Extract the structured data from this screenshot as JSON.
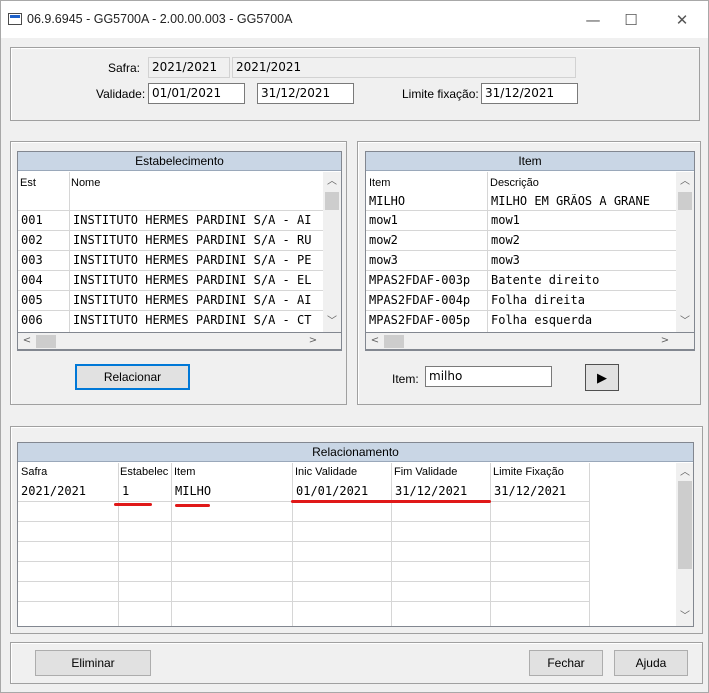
{
  "window": {
    "title": "06.9.6945 - GG5700A - 2.00.00.003 - GG5700A",
    "minimize": "—",
    "maximize": "☐",
    "close": "✕"
  },
  "top": {
    "safra_label": "Safra:",
    "safra_value1": "2021/2021",
    "safra_value2": "2021/2021",
    "validade_label": "Validade:",
    "validade_from": "01/01/2021",
    "validade_to": "31/12/2021",
    "limite_label": "Limite fixação:",
    "limite_value": "31/12/2021"
  },
  "estabelecimento": {
    "title": "Estabelecimento",
    "col_est": "Est",
    "col_nome": "Nome",
    "rows": [
      {
        "est": "001",
        "nome": "INSTITUTO HERMES PARDINI S/A - AI"
      },
      {
        "est": "002",
        "nome": "INSTITUTO HERMES PARDINI S/A - RU"
      },
      {
        "est": "003",
        "nome": "INSTITUTO HERMES PARDINI S/A - PE"
      },
      {
        "est": "004",
        "nome": "INSTITUTO HERMES PARDINI S/A - EL"
      },
      {
        "est": "005",
        "nome": "INSTITUTO HERMES PARDINI S/A - AI"
      },
      {
        "est": "006",
        "nome": "INSTITUTO HERMES PARDINI S/A - CT"
      }
    ],
    "relacionar_button": "Relacionar"
  },
  "item": {
    "title": "Item",
    "col_item": "Item",
    "col_desc": "Descrição",
    "rows": [
      {
        "item": "MILHO",
        "desc": "MILHO EM GRÃOS A GRANE"
      },
      {
        "item": "mow1",
        "desc": "mow1"
      },
      {
        "item": "mow2",
        "desc": "mow2"
      },
      {
        "item": "mow3",
        "desc": "mow3"
      },
      {
        "item": "MPAS2FDAF-003p",
        "desc": "Batente direito"
      },
      {
        "item": "MPAS2FDAF-004p",
        "desc": "Folha direita"
      },
      {
        "item": "MPAS2FDAF-005p",
        "desc": "Folha esquerda"
      }
    ],
    "search_label": "Item:",
    "search_value": "milho",
    "go_button": "▶"
  },
  "relacionamento": {
    "title": "Relacionamento",
    "columns": [
      "Safra",
      "Estabelec",
      "Item",
      "Inic Validade",
      "Fim Validade",
      "Limite Fixação"
    ],
    "rows": [
      {
        "safra": "2021/2021",
        "estab": "1",
        "item": "MILHO",
        "inic": "01/01/2021",
        "fim": "31/12/2021",
        "limite": "31/12/2021"
      }
    ]
  },
  "footer": {
    "eliminar": "Eliminar",
    "fechar": "Fechar",
    "ajuda": "Ajuda"
  },
  "colors": {
    "grid_header": "#c9d6e5",
    "annotation": "#e01818"
  }
}
